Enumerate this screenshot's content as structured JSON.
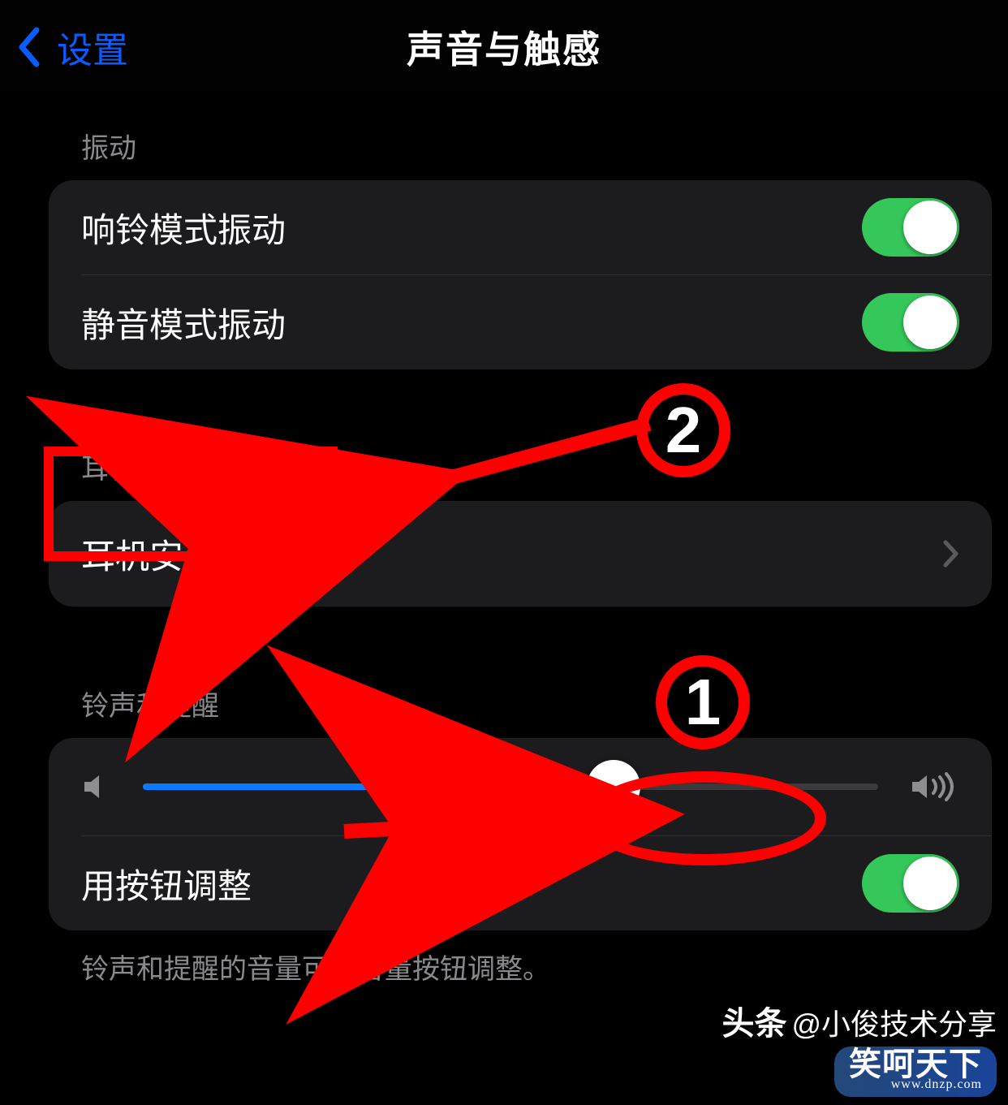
{
  "header": {
    "back_label": "设置",
    "title": "声音与触感"
  },
  "section_vibrate": {
    "label": "振动",
    "ring_vibrate": {
      "label": "响铃模式振动",
      "on": true
    },
    "silent_vibrate": {
      "label": "静音模式振动",
      "on": true
    }
  },
  "section_headphone": {
    "label": "耳机音频",
    "safety": {
      "label": "耳机安全"
    }
  },
  "section_ringer": {
    "label": "铃声和提醒",
    "slider_percent": 64,
    "change_with_buttons": {
      "label": "用按钮调整",
      "on": true
    },
    "footer": "铃声和提醒的音量可用音量按钮调整。"
  },
  "annotations": {
    "step1": "1",
    "step2": "2"
  },
  "watermark": {
    "tag": "头条",
    "handle": "@小俊技术分享",
    "site_title": "笑呵天下",
    "site_url": "www.dnzp.com"
  },
  "colors": {
    "accent_blue": "#0a5cff",
    "toggle_green": "#35c759",
    "slider_blue": "#0a7aff",
    "annotation_red": "#ff0000"
  }
}
